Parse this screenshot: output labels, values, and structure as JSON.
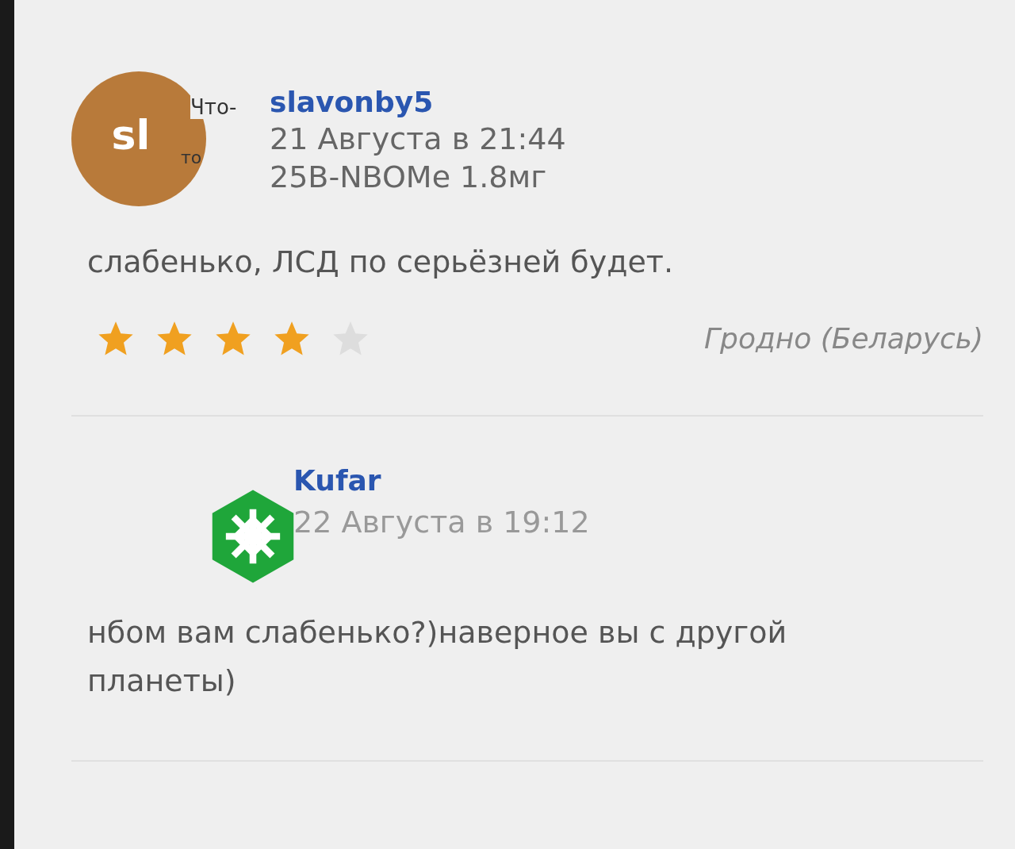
{
  "reviews": [
    {
      "avatar": {
        "initials": "sl",
        "color": "#b87a3a"
      },
      "overlay_text": [
        "Что-",
        "то"
      ],
      "author": "slavonby5",
      "date": "21 Августа в 21:44",
      "product": "25B-NBOMe 1.8мг",
      "text": "слабенько, ЛСД по серьёзней будет.",
      "stars": 4,
      "location": "Гродно (Беларусь)"
    }
  ],
  "reply": {
    "author": "Kufar",
    "date": "22 Августа в 19:12",
    "text": "нбом вам слабенько?)наверное вы с другой планеты)"
  }
}
